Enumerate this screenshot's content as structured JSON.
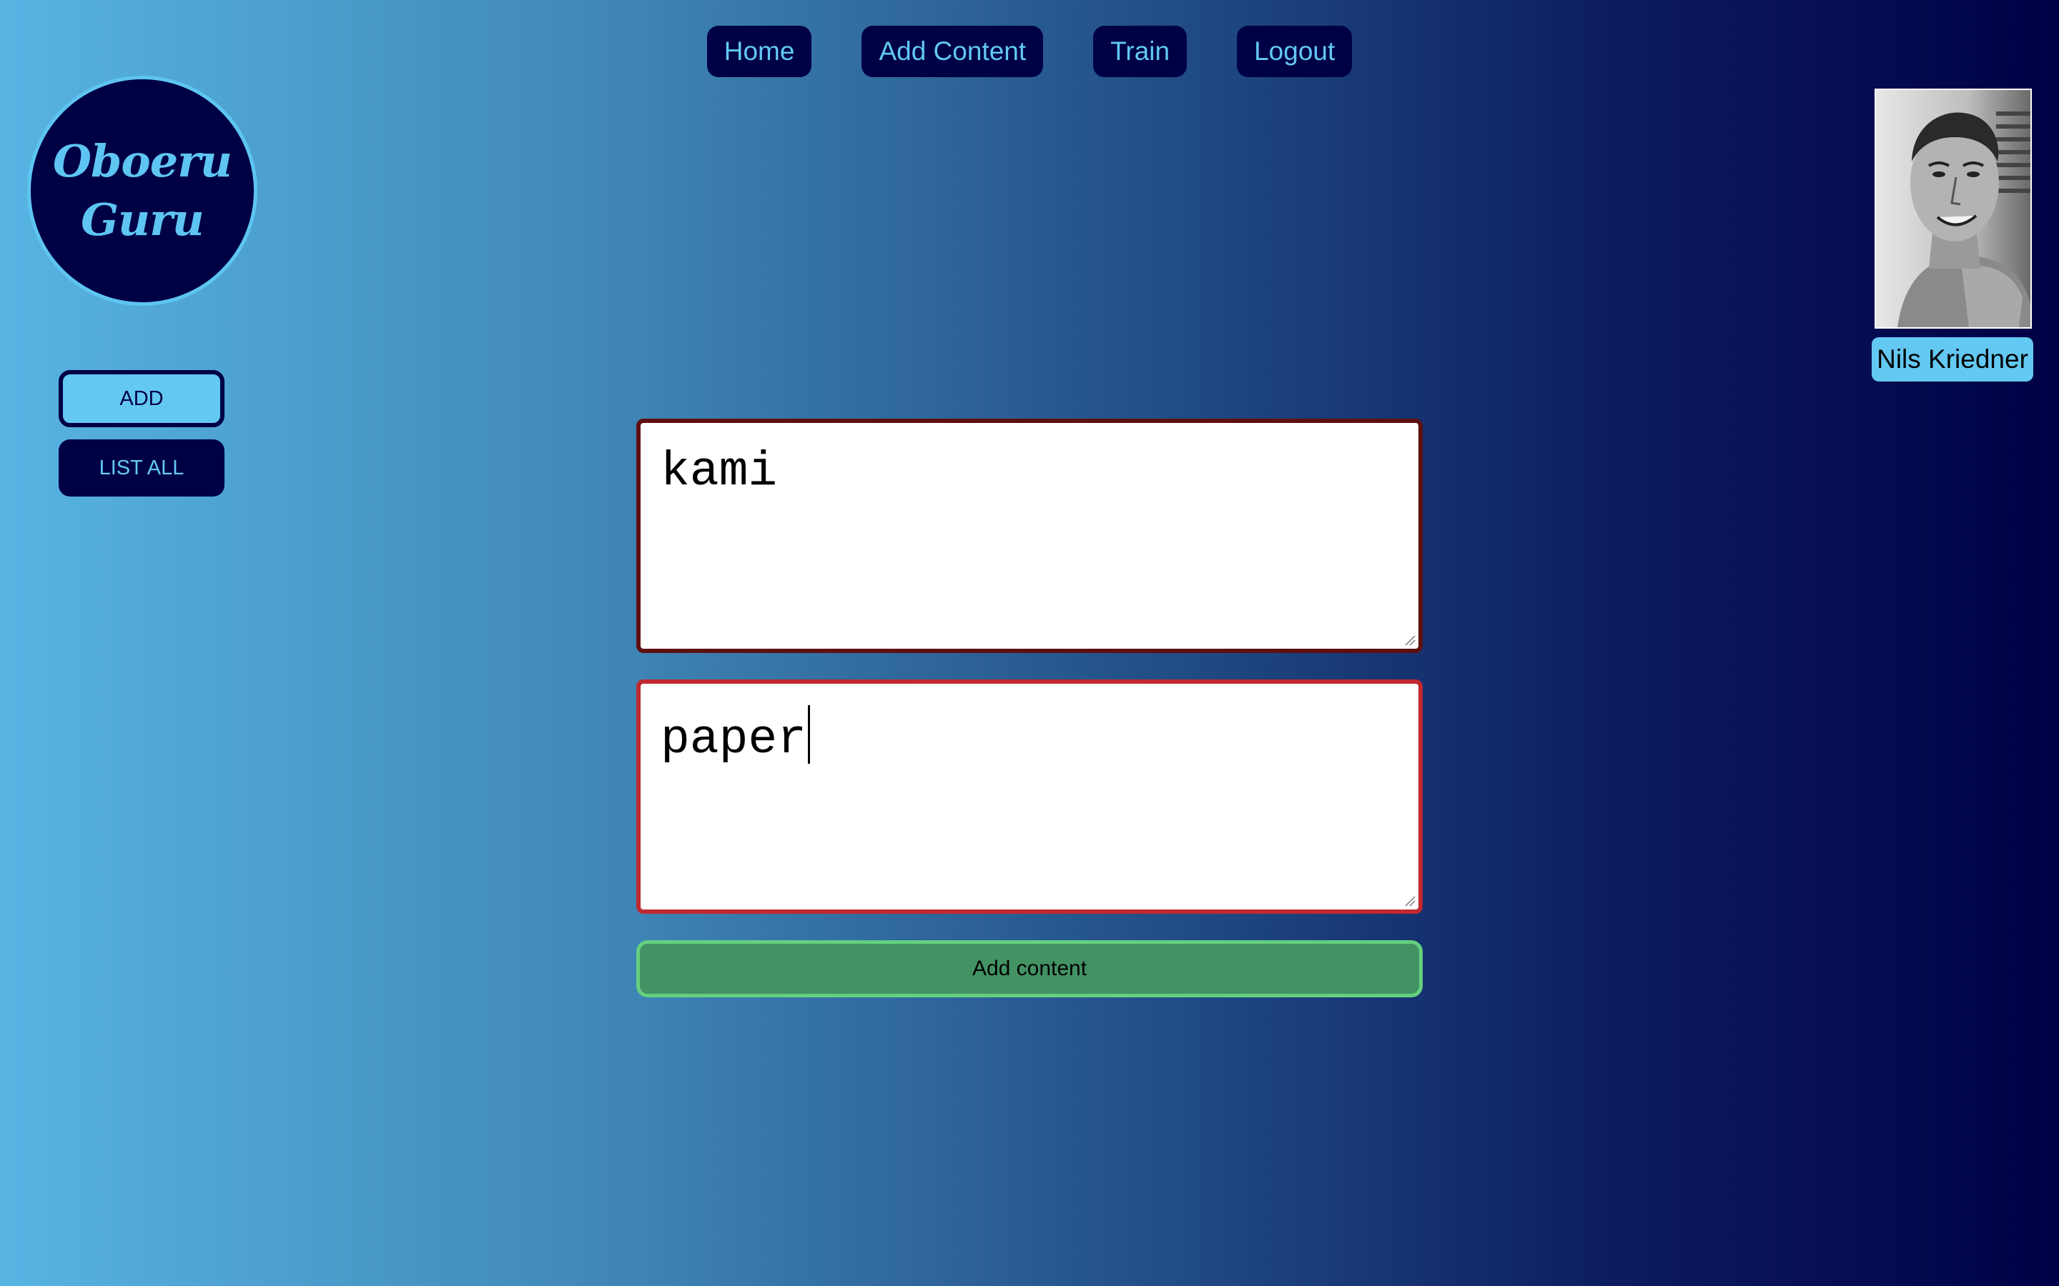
{
  "nav": {
    "items": [
      {
        "label": "Home"
      },
      {
        "label": "Add Content"
      },
      {
        "label": "Train"
      },
      {
        "label": "Logout"
      }
    ]
  },
  "logo": {
    "text": "Oboeru\nGuru"
  },
  "sidebar": {
    "add_label": "ADD",
    "list_label": "LIST ALL"
  },
  "user": {
    "name": "Nils Kriedner",
    "avatar_icon": "user-photo"
  },
  "form": {
    "front_value": "kami",
    "back_value": "paper",
    "submit_label": "Add content"
  },
  "colors": {
    "dark_navy": "#000045",
    "accent_cyan": "#63c8f2",
    "submit_green": "#439264",
    "front_border": "#5e1010",
    "back_border": "#c0292f"
  }
}
